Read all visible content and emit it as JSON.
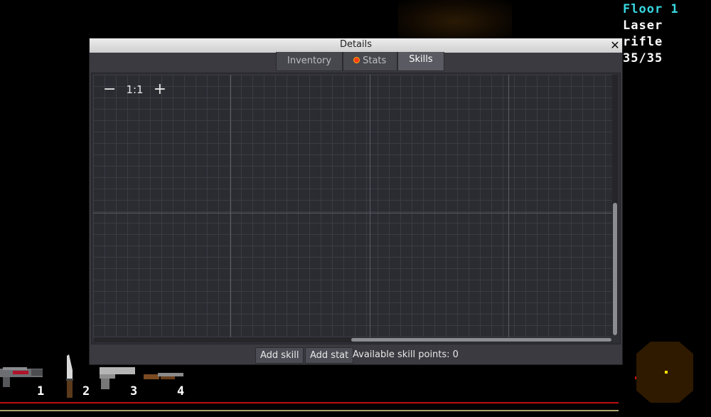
{
  "hud": {
    "floor": "Floor 1",
    "weapon_name": "Laser rifle",
    "ammo": "35/35"
  },
  "window": {
    "title": "Details",
    "tabs": [
      {
        "label": "Inventory",
        "active": false
      },
      {
        "label": "Stats",
        "active": false,
        "notification": true
      },
      {
        "label": "Skills",
        "active": true
      }
    ],
    "zoom": {
      "minus": "−",
      "level": "1:1",
      "plus": "+"
    },
    "buttons": {
      "add_skill": "Add skill",
      "add_stat": "Add stat"
    },
    "skill_points": "Available skill points: 0"
  },
  "hotbar": [
    {
      "slot": "1",
      "icon": "laser-rifle-icon"
    },
    {
      "slot": "2",
      "icon": "knife-icon"
    },
    {
      "slot": "3",
      "icon": "pistol-icon"
    },
    {
      "slot": "4",
      "icon": "shotgun-icon"
    }
  ],
  "colors": {
    "floor_text": "#37d7e0",
    "health_bar": "#c00d10",
    "stamina_bar": "#b2a46c",
    "minimap": "#2f1a00"
  }
}
